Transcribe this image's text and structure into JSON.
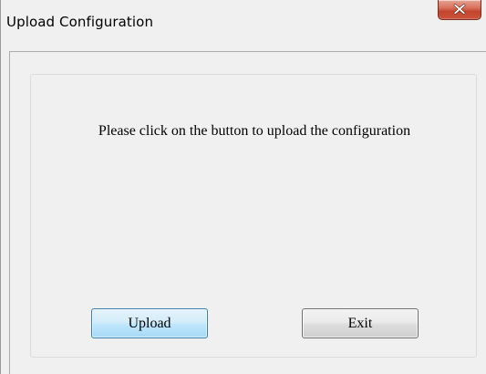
{
  "window": {
    "title": "Upload Configuration"
  },
  "icons": {
    "close": "close-icon"
  },
  "main": {
    "message": "Please click on the button to upload the configuration"
  },
  "buttons": {
    "upload_label": "Upload",
    "exit_label": "Exit"
  },
  "colors": {
    "window_background": "#f0f0f0",
    "close_button": "#c4442d",
    "upload_button_border": "#3c7fb1",
    "upload_button_fill": "#bee6fd",
    "exit_button_border": "#707070"
  }
}
